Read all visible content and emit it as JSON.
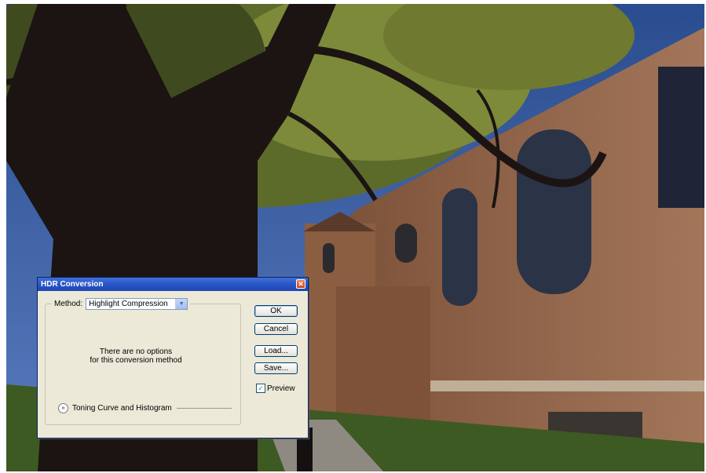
{
  "dialog": {
    "title": "HDR Conversion",
    "close_glyph": "✕",
    "method_label": "Method:",
    "method_value": "Highlight Compression",
    "dropdown_glyph": "▼",
    "message_line1": "There are no options",
    "message_line2": "for this conversion method",
    "toning_toggle_glyph": "»",
    "toning_label": "Toning Curve and Histogram",
    "buttons": {
      "ok": "OK",
      "cancel": "Cancel",
      "load": "Load...",
      "save": "Save..."
    },
    "preview_label": "Preview",
    "preview_checked": true,
    "check_glyph": "✓"
  },
  "colors": {
    "title_bar": "#2a56c7",
    "dialog_bg": "#ece9d8"
  }
}
